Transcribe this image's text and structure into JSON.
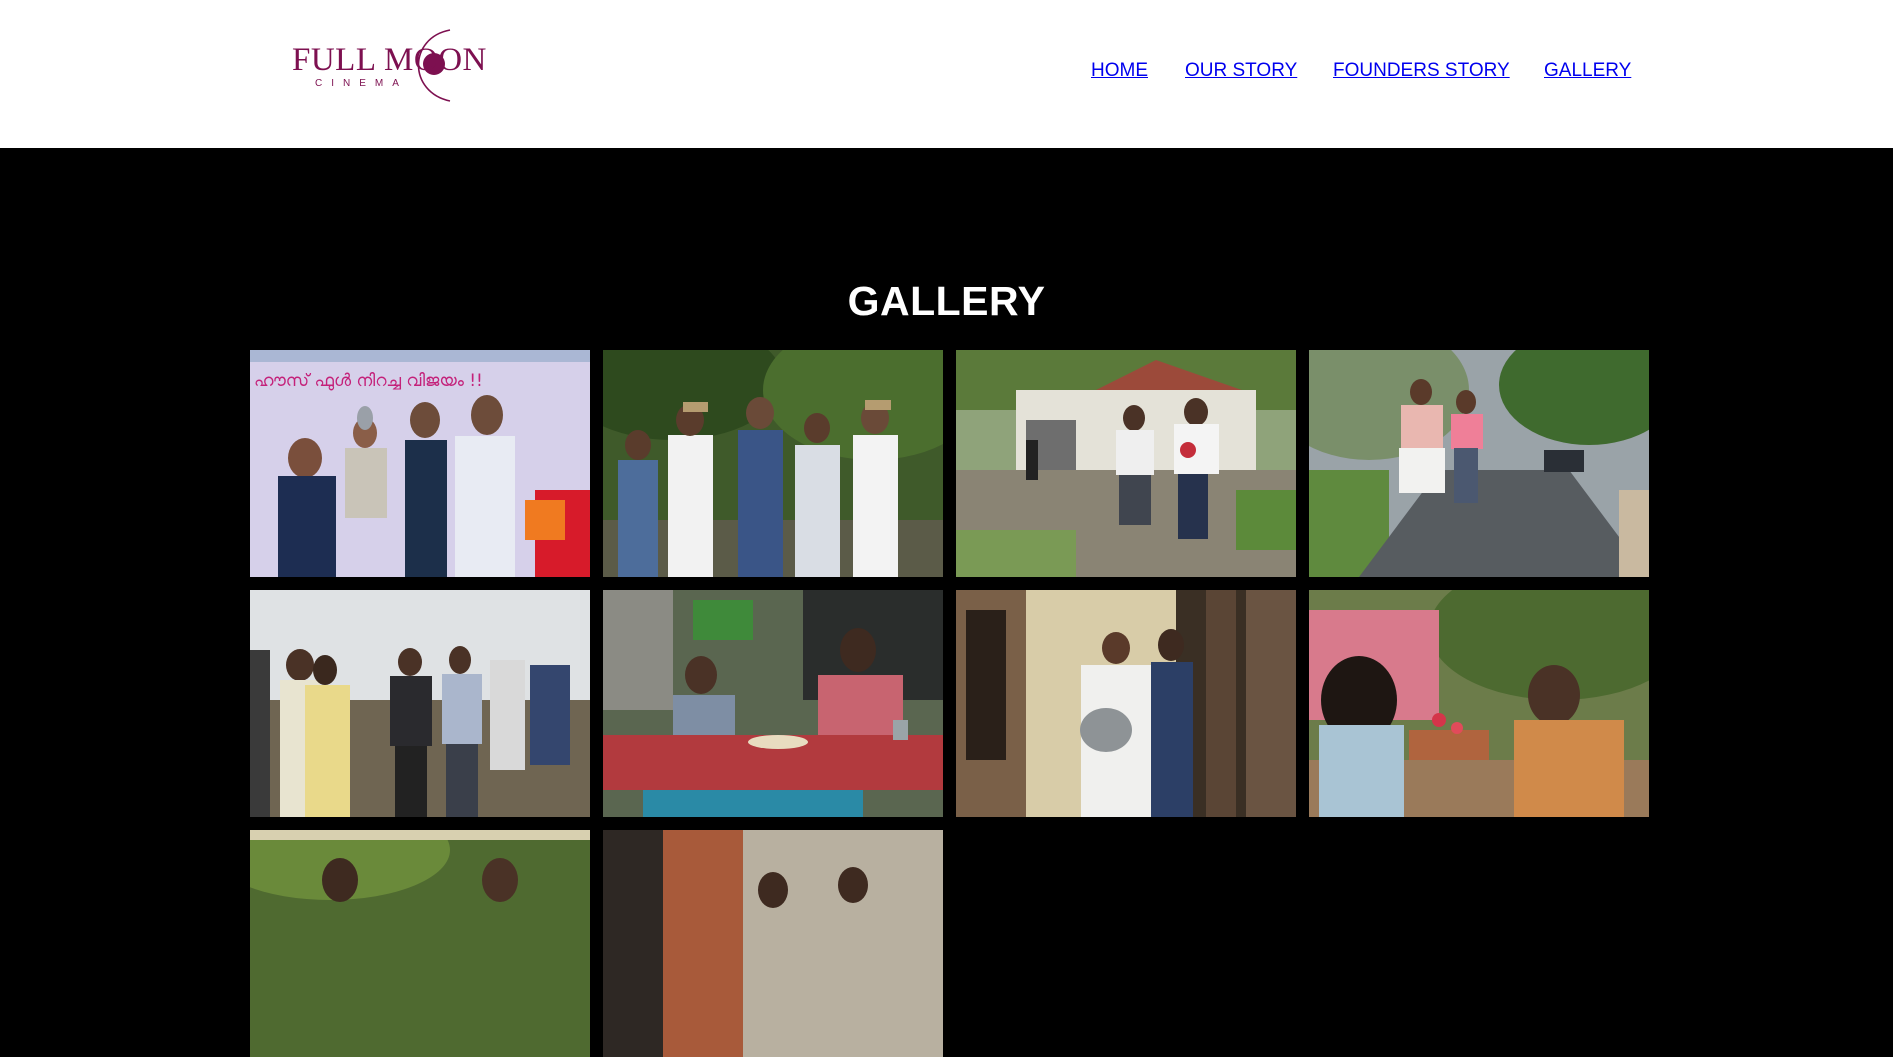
{
  "header": {
    "logo": {
      "name": "FULL MOON",
      "tagline": "CINEMA",
      "brand_color": "#7d1050"
    },
    "nav": [
      {
        "label": "HOME",
        "active": false
      },
      {
        "label": "OUR STORY",
        "active": false
      },
      {
        "label": "FOUNDERS STORY",
        "active": false
      },
      {
        "label": "GALLERY",
        "active": true
      }
    ],
    "nav_color": "#283175",
    "nav_active_color": "#e8196b"
  },
  "gallery": {
    "title": "GALLERY",
    "background": "#000000",
    "photos": [
      {
        "description": "promo-event-award-photo",
        "poster_text": "ഹൗസ് ഫുൾ നിറച്ച വിജയം !!"
      },
      {
        "description": "cast-group-outdoors-photo"
      },
      {
        "description": "running-scene-photo"
      },
      {
        "description": "road-running-scene-photo"
      },
      {
        "description": "on-set-crew-photo"
      },
      {
        "description": "tea-shop-scene-photo"
      },
      {
        "description": "house-kitchen-scene-photo"
      },
      {
        "description": "garden-conversation-scene-photo"
      },
      {
        "description": "outdoor-scene-photo"
      },
      {
        "description": "college-corridor-scene-photo"
      }
    ]
  }
}
